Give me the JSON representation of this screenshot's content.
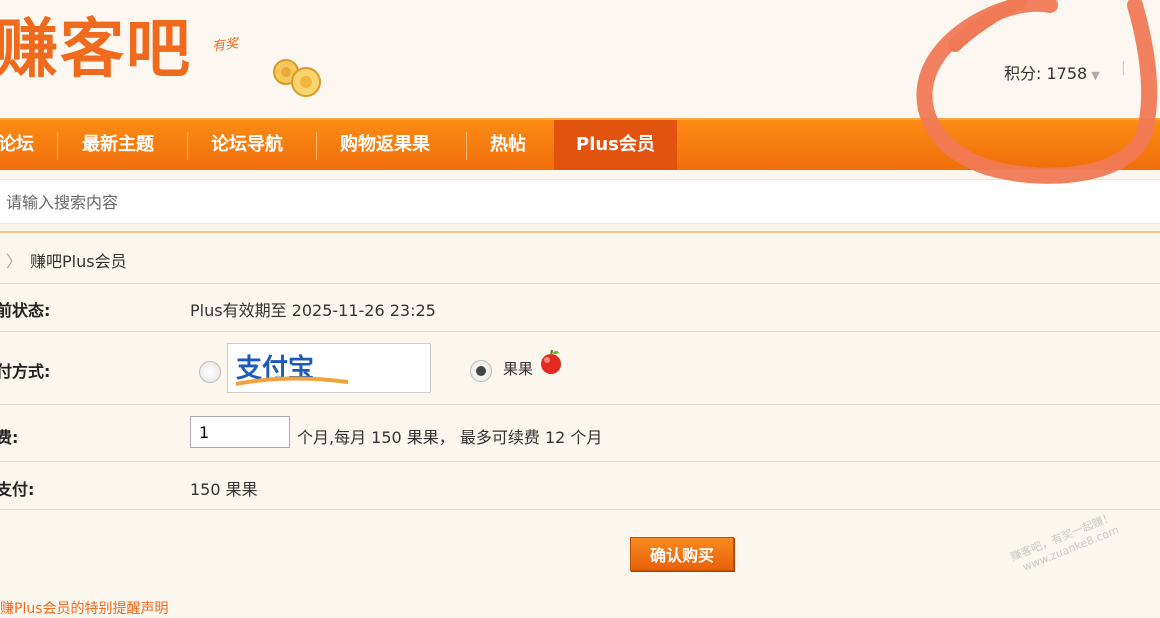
{
  "header": {
    "logo_text": "赚客吧",
    "logo_sub": "有奖",
    "points_label": "积分: 1758",
    "points_caret": "▼",
    "right_sep": "|",
    "right_edge": "I"
  },
  "nav": {
    "items": [
      {
        "label": "论坛"
      },
      {
        "label": "最新主题"
      },
      {
        "label": "论坛导航"
      },
      {
        "label": "购物返果果"
      },
      {
        "label": "热帖"
      },
      {
        "label": "Plus会员",
        "active": true
      }
    ]
  },
  "search": {
    "placeholder": "请输入搜索内容"
  },
  "breadcrumb": {
    "separator": "〉",
    "current": "赚吧Plus会员"
  },
  "form": {
    "status_label": "前状态:",
    "status_value": "Plus有效期至 2025-11-26 23:25",
    "payment_label": "付方式:",
    "payment_options": [
      {
        "label": "支付宝",
        "checked": false
      },
      {
        "label": "果果",
        "checked": true
      }
    ],
    "renew_label": "费:",
    "months_value": "1",
    "renew_desc": "个月,每月 150 果果， 最多可续费 12 个月",
    "pay_label": "支付:",
    "pay_value": "150 果果",
    "confirm_button": "确认购买"
  },
  "watermark": {
    "line1": "赚客吧，有奖一起赚！",
    "line2": "www.zuanke8.com"
  },
  "footer": {
    "hint": "赚Plus会员的特别提醒声明"
  },
  "colors": {
    "accent": "#f26e0b",
    "accent_active": "#e2530f",
    "scribble": "#f07a55"
  }
}
